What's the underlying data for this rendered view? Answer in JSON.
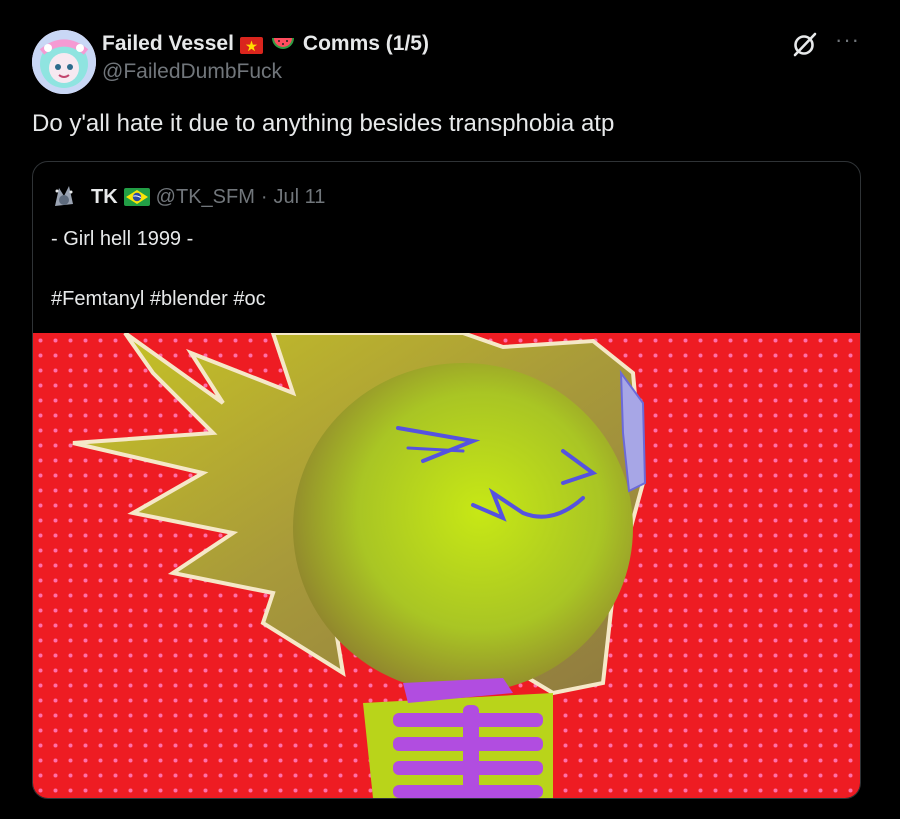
{
  "author": {
    "display_name": "Failed Vessel",
    "flag": "vietnam-flag-icon",
    "emoji": "watermelon-icon",
    "name_suffix": "Comms (1/5)",
    "handle": "@FailedDumbFuck"
  },
  "tweet": {
    "text": "Do y'all hate it due to anything besides transphobia atp"
  },
  "icons": {
    "grok": "grok-icon",
    "more": "···"
  },
  "quote": {
    "name": "TK",
    "flag": "brazil-flag-icon",
    "handle": "@TK_SFM",
    "separator": "·",
    "date": "Jul 11",
    "line1": "- Girl hell 1999 -",
    "line2": "#Femtanyl #blender #oc"
  },
  "colors": {
    "background": "#000000",
    "text": "#e7e9ea",
    "muted": "#71767b",
    "border": "#2f3336",
    "media_bg": "#ee1c23"
  }
}
